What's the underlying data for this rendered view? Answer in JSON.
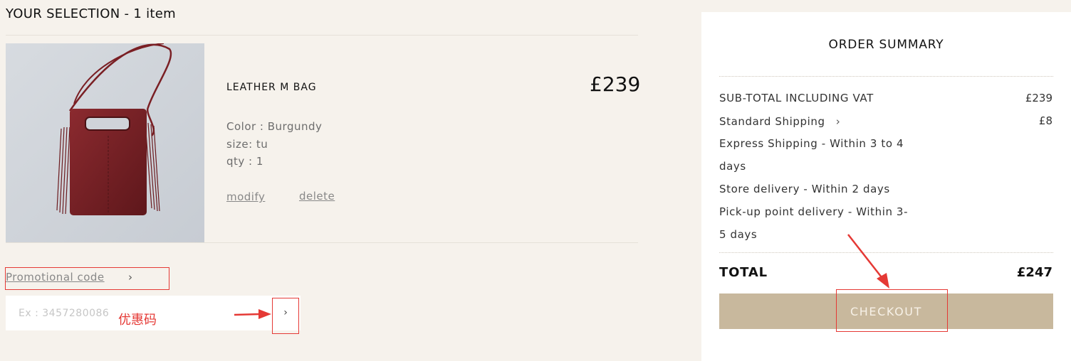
{
  "selection": {
    "title": "YOUR SELECTION - 1 item",
    "item": {
      "name": "LEATHER M BAG",
      "price": "£239",
      "color": "Color : Burgundy",
      "size": "size: tu",
      "qty": "qty : 1",
      "modify_label": "modify",
      "delete_label": "delete"
    }
  },
  "promo": {
    "link_label": "Promotional code",
    "chevron": "›",
    "placeholder": "Ex : 3457280086",
    "submit_chevron": "›"
  },
  "annotation": {
    "promo_note": "优惠码"
  },
  "summary": {
    "title": "ORDER SUMMARY",
    "subtotal_label": "SUB-TOTAL INCLUDING VAT",
    "subtotal_value": "£239",
    "standard_label": "Standard Shipping",
    "standard_chevron": "›",
    "standard_value": "£8",
    "express_line1": "Express Shipping - Within 3 to 4",
    "express_line2": "days",
    "store_label": "Store delivery - Within 2 days",
    "pickup_line1": "Pick-up point delivery - Within 3-",
    "pickup_line2": "5 days",
    "total_label": "TOTAL",
    "total_value": "£247",
    "checkout_label": "CHECKOUT"
  },
  "colors": {
    "background": "#f6f2ec",
    "checkout_button": "#c8b89d",
    "annotation_red": "#e53935",
    "bag_burgundy": "#7a1f24"
  }
}
